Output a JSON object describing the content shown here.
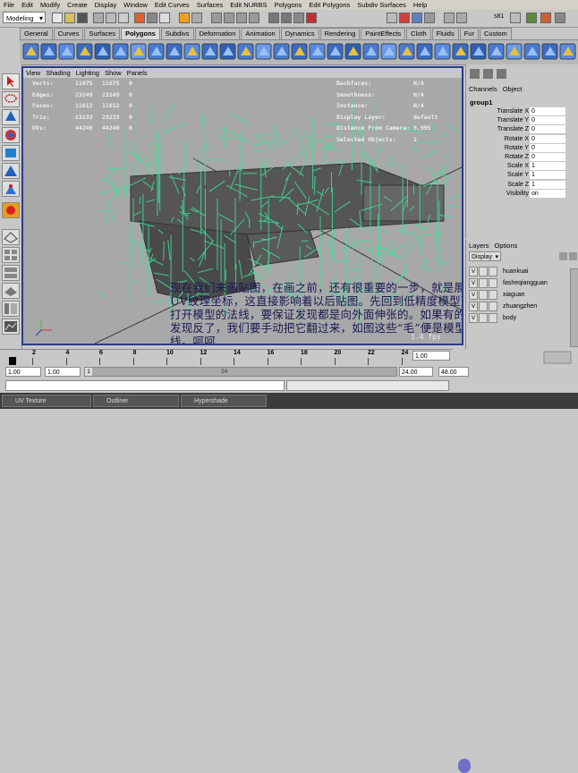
{
  "menubar": [
    "File",
    "Edit",
    "Modify",
    "Create",
    "Display",
    "Window",
    "Edit Curves",
    "Surfaces",
    "Edit NURBS",
    "Polygons",
    "Edit Polygons",
    "Subdiv Surfaces",
    "Help"
  ],
  "status": {
    "mode": "Modeling",
    "frame_label": "s81"
  },
  "shelf_tabs": [
    "General",
    "Curves",
    "Surfaces",
    "Polygons",
    "Subdivs",
    "Deformation",
    "Animation",
    "Dynamics",
    "Rendering",
    "PaintEffects",
    "Cloth",
    "Fluids",
    "Fur",
    "Custom"
  ],
  "active_shelf": "Polygons",
  "viewport": {
    "menu": [
      "View",
      "Shading",
      "Lighting",
      "Show",
      "Panels"
    ],
    "hud_left": [
      {
        "label": "Verts:",
        "v1": "11675",
        "v2": "11675",
        "v3": "0"
      },
      {
        "label": "Edges:",
        "v1": "23249",
        "v2": "23249",
        "v3": "0"
      },
      {
        "label": "Faces:",
        "v1": "11612",
        "v2": "11612",
        "v3": "0"
      },
      {
        "label": "Tris:",
        "v1": "23233",
        "v2": "23233",
        "v3": "0"
      },
      {
        "label": "UVs:",
        "v1": "44240",
        "v2": "44240",
        "v3": "0"
      }
    ],
    "hud_right": [
      {
        "label": "Backfaces:",
        "value": "N/A"
      },
      {
        "label": "Smoothness:",
        "value": "N/A"
      },
      {
        "label": "Instance:",
        "value": "N/A"
      },
      {
        "label": "Display Layer:",
        "value": "default"
      },
      {
        "label": "Distance From Camera:",
        "value": "9.995"
      },
      {
        "label": "Selected Objects:",
        "value": "1"
      }
    ],
    "subtitle": "现在我们来画贴图，在画之前，还有很重要的一步，就是展开UV纹理坐标，这直接影响着以后贴图。先回到低精度模型下，打开模型的法线，要保证发现都是向外面伸张的。如果有的面的发现反了，我们要手动把它翻过来，如图这些“毛”便是模型的法线。呵呵",
    "fps": "1.4 fps"
  },
  "channelbox": {
    "tabs": [
      "Channels",
      "Object"
    ],
    "object": "group1",
    "channels": [
      {
        "label": "Translate X",
        "value": "0"
      },
      {
        "label": "Translate Y",
        "value": "0"
      },
      {
        "label": "Translate Z",
        "value": "0"
      },
      {
        "label": "Rotate X",
        "value": "0"
      },
      {
        "label": "Rotate Y",
        "value": "0"
      },
      {
        "label": "Rotate Z",
        "value": "0"
      },
      {
        "label": "Scale X",
        "value": "1"
      },
      {
        "label": "Scale Y",
        "value": "1"
      },
      {
        "label": "Scale Z",
        "value": "1"
      },
      {
        "label": "Visibility",
        "value": "on"
      }
    ]
  },
  "layers": {
    "tabs": [
      "Layers",
      "Options"
    ],
    "display": "Display",
    "items": [
      "huankuai",
      "fasheqiangguan",
      "xiaguan",
      "zhuangzhen",
      "body"
    ]
  },
  "timeslider": {
    "ticks": [
      "2",
      "4",
      "6",
      "8",
      "10",
      "12",
      "14",
      "16",
      "18",
      "20",
      "22",
      "24"
    ],
    "current": "1"
  },
  "range": {
    "start": "1.00",
    "inner_start": "1.00",
    "frame": "1",
    "mid": "24",
    "inner_end": "24.00",
    "end": "48.00",
    "right": "1.00"
  },
  "taskbar": [
    "UV Texture",
    "Outliner",
    "Hypershade"
  ]
}
